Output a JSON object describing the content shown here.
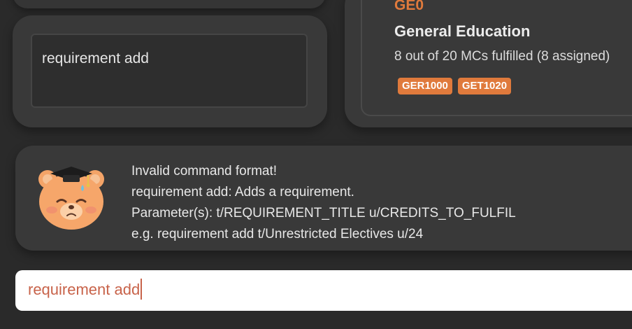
{
  "command_history": {
    "text": "requirement add"
  },
  "requirement_card": {
    "code": "GE0",
    "title": "General Education",
    "progress": "8 out of 20 MCs fulfilled (8 assigned)",
    "modules": [
      "GER1000",
      "GET1020"
    ]
  },
  "result": {
    "mascot_icon": "graduation-bear-icon",
    "lines": [
      "Invalid command format!",
      "requirement add: Adds a requirement.",
      "Parameter(s): t/REQUIREMENT_TITLE u/CREDITS_TO_FULFIL",
      "e.g. requirement add t/Unrestricted Electives u/24"
    ]
  },
  "command_box": {
    "value": "requirement add"
  },
  "colors": {
    "background": "#2a2a2a",
    "panel": "#393939",
    "accent": "#e07a3c",
    "input_text": "#c8634a"
  }
}
